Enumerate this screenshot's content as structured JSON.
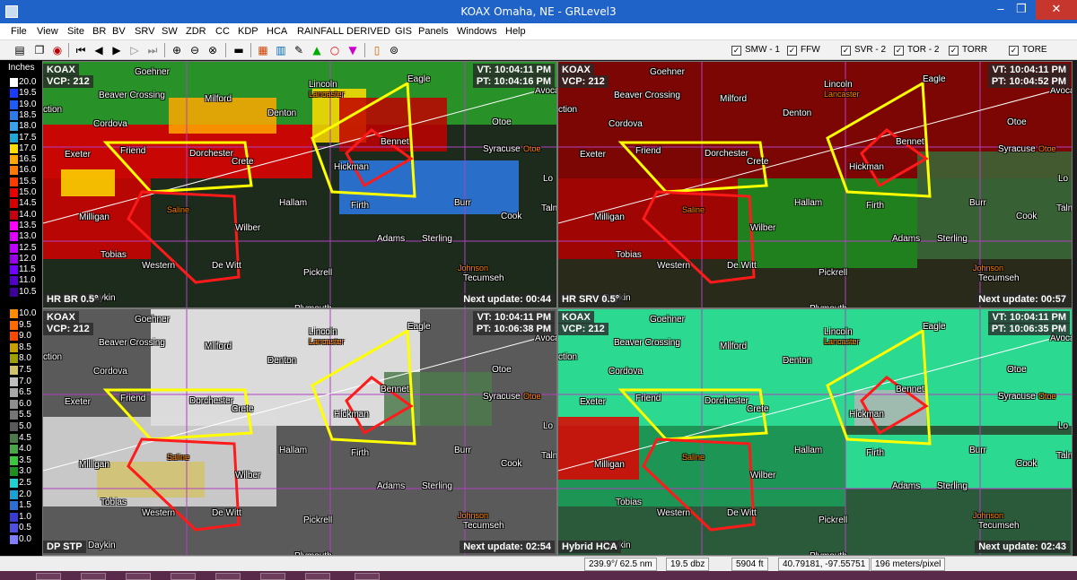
{
  "window": {
    "title": "KOAX Omaha, NE - GRLevel3",
    "minimize": "–",
    "restore": "❐",
    "close": "✕"
  },
  "menu": [
    "File",
    "View",
    "Site",
    "BR",
    "BV",
    "SRV",
    "SW",
    "ZDR",
    "CC",
    "KDP",
    "HCA",
    "RAINFALL",
    "DERIVED",
    "GIS",
    "Panels",
    "Windows",
    "Help"
  ],
  "toolbar": {
    "icons": [
      "disk-icon",
      "copy-icon",
      "radar-icon",
      "first-frame-icon",
      "prev-frame-icon",
      "play-icon",
      "next-frame-icon",
      "last-frame-icon",
      "zoom-in-icon",
      "zoom-out-icon",
      "zoom-reset-icon",
      "window-icon",
      "map-icon",
      "layers-icon",
      "pin-icon",
      "triangle-icon",
      "circle-icon",
      "down-triangle-icon",
      "phone-icon",
      "settings-icon"
    ],
    "warnings": [
      {
        "label": "SMW - 1",
        "checked": true
      },
      {
        "label": "FFW",
        "checked": true
      },
      {
        "label": "SVR - 2",
        "checked": true
      },
      {
        "label": "TOR - 2",
        "checked": true
      },
      {
        "label": "TORR",
        "checked": true
      },
      {
        "label": "TORE",
        "checked": true
      }
    ]
  },
  "legend": {
    "title": "Inches",
    "top_values": [
      "20.0",
      "19.5",
      "19.0",
      "18.5",
      "18.0",
      "17.5",
      "17.0",
      "16.5",
      "16.0",
      "15.5",
      "15.0",
      "14.5",
      "14.0",
      "13.5",
      "13.0",
      "12.5",
      "12.0",
      "11.5",
      "11.0",
      "10.5"
    ],
    "top_colors": [
      "#ffffff",
      "#1a3cff",
      "#1f5cf5",
      "#2b7be9",
      "#3aa0ea",
      "#1ea8d8",
      "#ffdd00",
      "#ffa800",
      "#ff7a00",
      "#ff3c00",
      "#e60000",
      "#d80000",
      "#c20012",
      "#ff00ff",
      "#e000ff",
      "#bf00ff",
      "#9a00e8",
      "#7000ff",
      "#5000c8",
      "#3b009a"
    ],
    "bottom_values": [
      "10.0",
      "9.5",
      "9.0",
      "8.5",
      "8.0",
      "7.5",
      "7.0",
      "6.5",
      "6.0",
      "5.5",
      "5.0",
      "4.5",
      "4.0",
      "3.5",
      "3.0",
      "2.5",
      "2.0",
      "1.5",
      "1.0",
      "0.5",
      "0.0"
    ],
    "bottom_colors": [
      "#ff8c00",
      "#ff6a00",
      "#ff4800",
      "#c8a000",
      "#9f9f00",
      "#d2c26c",
      "#bfbfbf",
      "#a8a8a8",
      "#8f8f8f",
      "#767676",
      "#5a5a5a",
      "#4d7a4d",
      "#4aa54a",
      "#3cc83c",
      "#1f8f1f",
      "#1fd2d2",
      "#1aa0d2",
      "#2d6fd2",
      "#3b3bd2",
      "#5050e0",
      "#8080ff"
    ]
  },
  "panels": [
    {
      "site": "KOAX",
      "vcp": "VCP: 212",
      "vt": "VT: 10:04:11 PM",
      "pt": "PT: 10:04:16 PM",
      "product": "HR BR 0.5°",
      "next": "Next update: 00:44"
    },
    {
      "site": "KOAX",
      "vcp": "VCP: 212",
      "vt": "VT: 10:04:11 PM",
      "pt": "PT: 10:04:52 PM",
      "product": "HR SRV 0.5°",
      "next": "Next update: 00:57"
    },
    {
      "site": "KOAX",
      "vcp": "VCP: 212",
      "vt": "VT: 10:04:11 PM",
      "pt": "PT: 10:06:38 PM",
      "product": "DP STP",
      "next": "Next update: 02:54"
    },
    {
      "site": "KOAX",
      "vcp": "VCP: 212",
      "vt": "VT: 10:04:11 PM",
      "pt": "PT: 10:06:35 PM",
      "product": "Hybrid HCA",
      "next": "Next update: 02:43"
    }
  ],
  "map_labels": {
    "towns": [
      "Goehner",
      "Lincoln",
      "Eagle",
      "Beaver Crossing",
      "Milford",
      "Cordova",
      "Denton",
      "Otoe",
      "Exeter",
      "Friend",
      "Dorchester",
      "Crete",
      "Bennet",
      "Syracuse",
      "Hickman",
      "Milligan",
      "Hallam",
      "Firth",
      "Burr",
      "Cook",
      "Wilber",
      "Adams",
      "Sterling",
      "Tobias",
      "Western",
      "De Witt",
      "Pickrell",
      "Tecumseh",
      "Daykin",
      "Avoca",
      "Plymouth"
    ],
    "counties": [
      "Lancaster",
      "Saline",
      "Johnson",
      "Otoe"
    ],
    "edge": [
      "ction",
      "Lo",
      "Talm"
    ]
  },
  "status": {
    "azran": "239.9°/ 62.5 nm",
    "value": "19.5 dbz",
    "height": "5904 ft",
    "latlon": "40.79181, -97.55751",
    "scale": "196 meters/pixel"
  }
}
